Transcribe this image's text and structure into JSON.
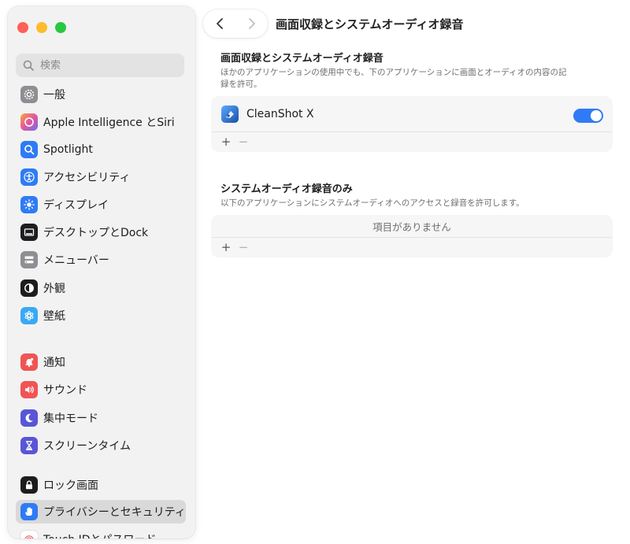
{
  "sidebar": {
    "search_placeholder": "検索",
    "items": [
      {
        "label": "一般",
        "icon": "gear-icon",
        "color": "#8e8e93"
      },
      {
        "label": "Apple Intelligence とSiri",
        "icon": "siri-icon",
        "color": "#d65bd3"
      },
      {
        "label": "Spotlight",
        "icon": "magnifier-icon",
        "color": "#2f7bf5"
      },
      {
        "label": "アクセシビリティ",
        "icon": "accessibility-icon",
        "color": "#2f7bf5"
      },
      {
        "label": "ディスプレイ",
        "icon": "sun-icon",
        "color": "#2f7bf5"
      },
      {
        "label": "デスクトップとDock",
        "icon": "dock-icon",
        "color": "#1d1d1f"
      },
      {
        "label": "メニューバー",
        "icon": "menubar-icon",
        "color": "#8e8e93"
      },
      {
        "label": "外観",
        "icon": "appearance-icon",
        "color": "#1d1d1f"
      },
      {
        "label": "壁紙",
        "icon": "wallpaper-icon",
        "color": "#3aa9f5"
      },
      {
        "label": "通知",
        "icon": "bell-icon",
        "color": "#f05454"
      },
      {
        "label": "サウンド",
        "icon": "speaker-icon",
        "color": "#f05454"
      },
      {
        "label": "集中モード",
        "icon": "moon-icon",
        "color": "#5856d6"
      },
      {
        "label": "スクリーンタイム",
        "icon": "hourglass-icon",
        "color": "#5856d6"
      },
      {
        "label": "ロック画面",
        "icon": "lock-icon",
        "color": "#1d1d1f"
      },
      {
        "label": "プライバシーとセキュリティ",
        "icon": "hand-icon",
        "color": "#2f7bf5"
      },
      {
        "label": "Touch IDとパスワード",
        "icon": "fingerprint-icon",
        "color": "#f05454"
      }
    ]
  },
  "toolbar": {
    "title": "画面収録とシステムオーディオ録音"
  },
  "section1": {
    "title": "画面収録とシステムオーディオ録音",
    "description": "ほかのアプリケーションの使用中でも、下のアプリケーションに画面とオーディオの内容の記録を許可。",
    "apps": [
      {
        "name": "CleanShot X",
        "enabled": true
      }
    ],
    "add_label": "+",
    "remove_label": "−"
  },
  "section2": {
    "title": "システムオーディオ録音のみ",
    "description": "以下のアプリケーションにシステムオーディオへのアクセスと録音を許可します。",
    "empty_text": "項目がありません",
    "add_label": "+",
    "remove_label": "−"
  },
  "colors": {
    "accent": "#2f7bf5",
    "sidebar_bg": "#f2f2f2",
    "selected_bg": "#d9d9d9"
  }
}
